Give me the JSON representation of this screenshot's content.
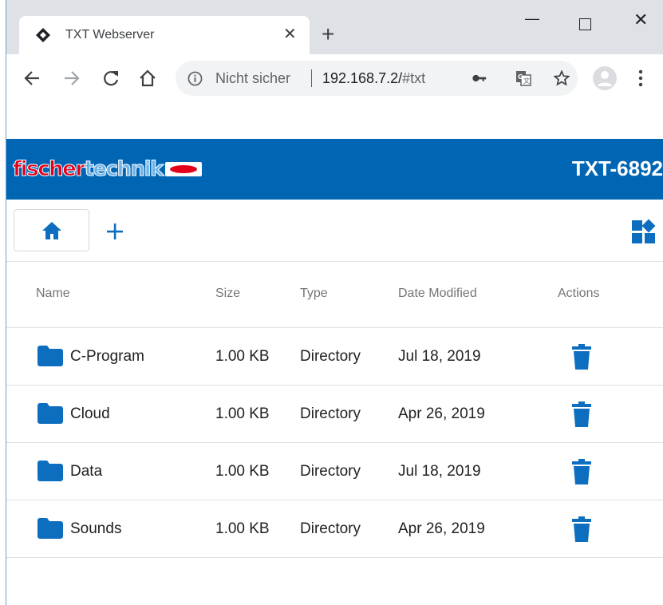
{
  "colors": {
    "brand_blue": "#0066b3",
    "icon_blue": "#0d6ebf",
    "tabstrip": "#dee1e6"
  },
  "browser": {
    "tab": {
      "title": "TXT Webserver",
      "favicon": "diamond-favicon-icon",
      "close_glyph": "✕"
    },
    "new_tab_glyph": "+",
    "window_controls": {
      "minimize_glyph": "—",
      "close_glyph": "✕"
    },
    "omnibox": {
      "security_label": "Nicht sicher",
      "url_host": "192.168.7.2/",
      "url_path": "#txt"
    }
  },
  "header": {
    "logo_text_1": "fischer",
    "logo_text_2": "technik",
    "title": "TXT-6892"
  },
  "table": {
    "columns": [
      "Name",
      "Size",
      "Type",
      "Date Modified",
      "Actions"
    ],
    "rows": [
      {
        "name": "C-Program",
        "size": "1.00 KB",
        "type": "Directory",
        "date": "Jul 18, 2019"
      },
      {
        "name": "Cloud",
        "size": "1.00 KB",
        "type": "Directory",
        "date": "Apr 26, 2019"
      },
      {
        "name": "Data",
        "size": "1.00 KB",
        "type": "Directory",
        "date": "Jul 18, 2019"
      },
      {
        "name": "Sounds",
        "size": "1.00 KB",
        "type": "Directory",
        "date": "Apr 26, 2019"
      }
    ]
  }
}
